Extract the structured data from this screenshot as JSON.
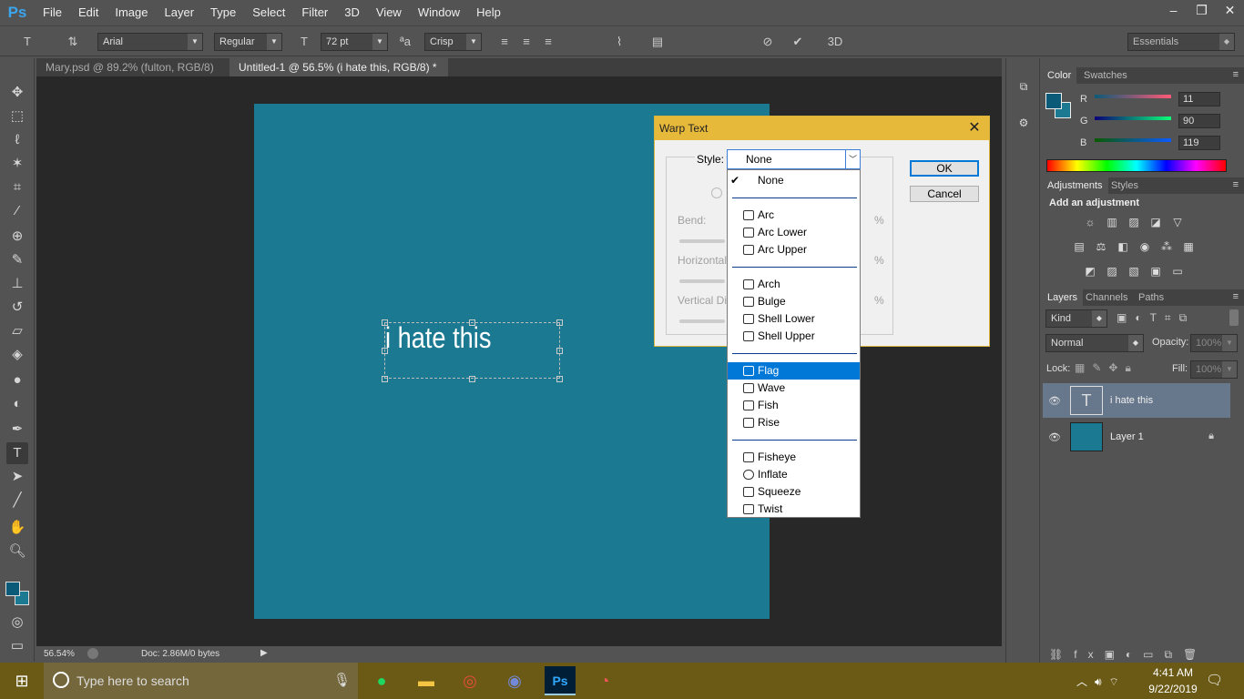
{
  "app": {
    "logo": "Ps"
  },
  "menubar": {
    "items": [
      "File",
      "Edit",
      "Image",
      "Layer",
      "Type",
      "Select",
      "Filter",
      "3D",
      "View",
      "Window",
      "Help"
    ]
  },
  "window_controls": {
    "minimize": "–",
    "restore": "❐",
    "close": "✕"
  },
  "options_bar": {
    "font_family": "Arial",
    "font_style": "Regular",
    "font_size": "72 pt",
    "antialias": "Crisp",
    "workspace": "Essentials",
    "label_3d": "3D",
    "text_color": "#ffffff"
  },
  "tabs": [
    {
      "label": "Mary.psd @ 89.2% (fulton, RGB/8)"
    },
    {
      "label": "Untitled-1 @ 56.5% (i hate this, RGB/8) *"
    }
  ],
  "canvas": {
    "text": "i hate this",
    "background_color": "#1b7a91"
  },
  "status": {
    "zoom": "56.54%",
    "doc": "Doc: 2.86M/0 bytes"
  },
  "dialog": {
    "title": "Warp Text",
    "style_label": "Style:",
    "style_value": "None",
    "ok": "OK",
    "cancel": "Cancel",
    "bend": "Bend:",
    "horizontal": "Horizontal",
    "vertical": "Vertical Di",
    "percent": "%"
  },
  "dropdown": {
    "options": [
      "None",
      "Arc",
      "Arc Lower",
      "Arc Upper",
      "Arch",
      "Bulge",
      "Shell Lower",
      "Shell Upper",
      "Flag",
      "Wave",
      "Fish",
      "Rise",
      "Fisheye",
      "Inflate",
      "Squeeze",
      "Twist"
    ],
    "checked": "None",
    "highlighted": "Flag"
  },
  "color_panel": {
    "tabs": [
      "Color",
      "Swatches"
    ],
    "r_label": "R",
    "g_label": "G",
    "b_label": "B",
    "r": "11",
    "g": "90",
    "b": "119",
    "foreground": "#0b5a77"
  },
  "adjustments": {
    "tabs": [
      "Adjustments",
      "Styles"
    ],
    "heading": "Add an adjustment"
  },
  "layers": {
    "tabs": [
      "Layers",
      "Channels",
      "Paths"
    ],
    "kind": "Kind",
    "blend": "Normal",
    "opacity_label": "Opacity:",
    "opacity": "100%",
    "lock_label": "Lock:",
    "fill_label": "Fill:",
    "fill": "100%",
    "items": [
      {
        "name": "i hate this",
        "thumb": "T"
      },
      {
        "name": "Layer 1"
      }
    ]
  },
  "taskbar": {
    "search_placeholder": "Type here to search",
    "time": "4:41 AM",
    "date": "9/22/2019",
    "ps_label": "Ps"
  }
}
